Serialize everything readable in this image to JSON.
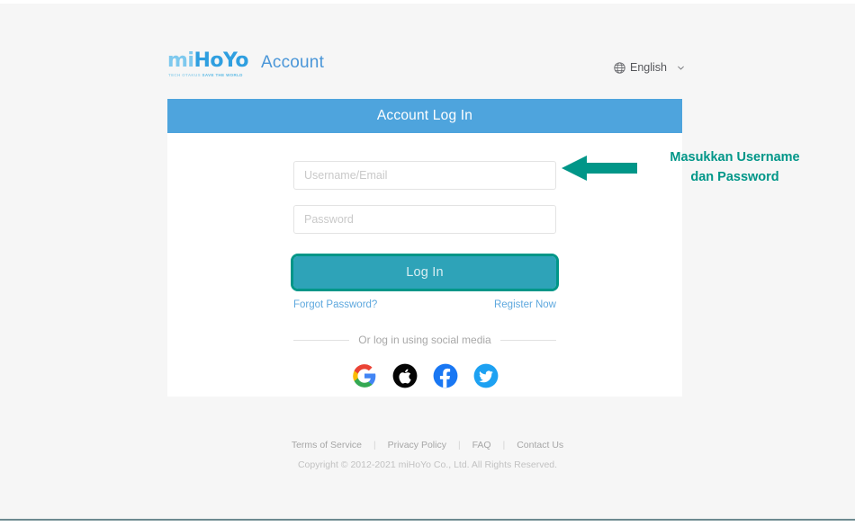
{
  "brand": {
    "logo_mi": "mi",
    "logo_ho": "Ho",
    "logo_yo": "Yo",
    "logo_tagline_1": "TECH OTAKUS",
    "logo_tagline_2": "SAVE THE WORLD",
    "account_title": "Account"
  },
  "language": {
    "icon": "globe-icon",
    "label": "English",
    "chevron": "chevron-down-icon"
  },
  "card": {
    "header_title": "Account Log In",
    "username_placeholder": "Username/Email",
    "username_value": "",
    "password_placeholder": "Password",
    "password_value": "",
    "login_label": "Log In",
    "forgot_label": "Forgot Password?",
    "register_label": "Register Now",
    "divider_text": "Or log in using social media",
    "social": [
      {
        "name": "google-icon",
        "label": "Google"
      },
      {
        "name": "apple-icon",
        "label": "Apple"
      },
      {
        "name": "facebook-icon",
        "label": "Facebook"
      },
      {
        "name": "twitter-icon",
        "label": "Twitter"
      }
    ]
  },
  "footer": {
    "links": [
      "Terms of Service",
      "Privacy Policy",
      "FAQ",
      "Contact Us"
    ],
    "separator": "|",
    "copyright": "Copyright © 2012-2021 miHoYo Co., Ltd. All Rights Reserved."
  },
  "annotation": {
    "line1": "Masukkan Username",
    "line2": "dan Password",
    "color": "#009688",
    "arrow": "left-arrow-annotation"
  },
  "colors": {
    "page_background": "#f6f6f6",
    "card_background": "#ffffff",
    "header_blue": "#4ea4dd",
    "login_button": "#2ea3b8",
    "link_blue": "#5ea8de",
    "annotation_teal": "#009688",
    "bottom_rule": "#6d8a90"
  }
}
